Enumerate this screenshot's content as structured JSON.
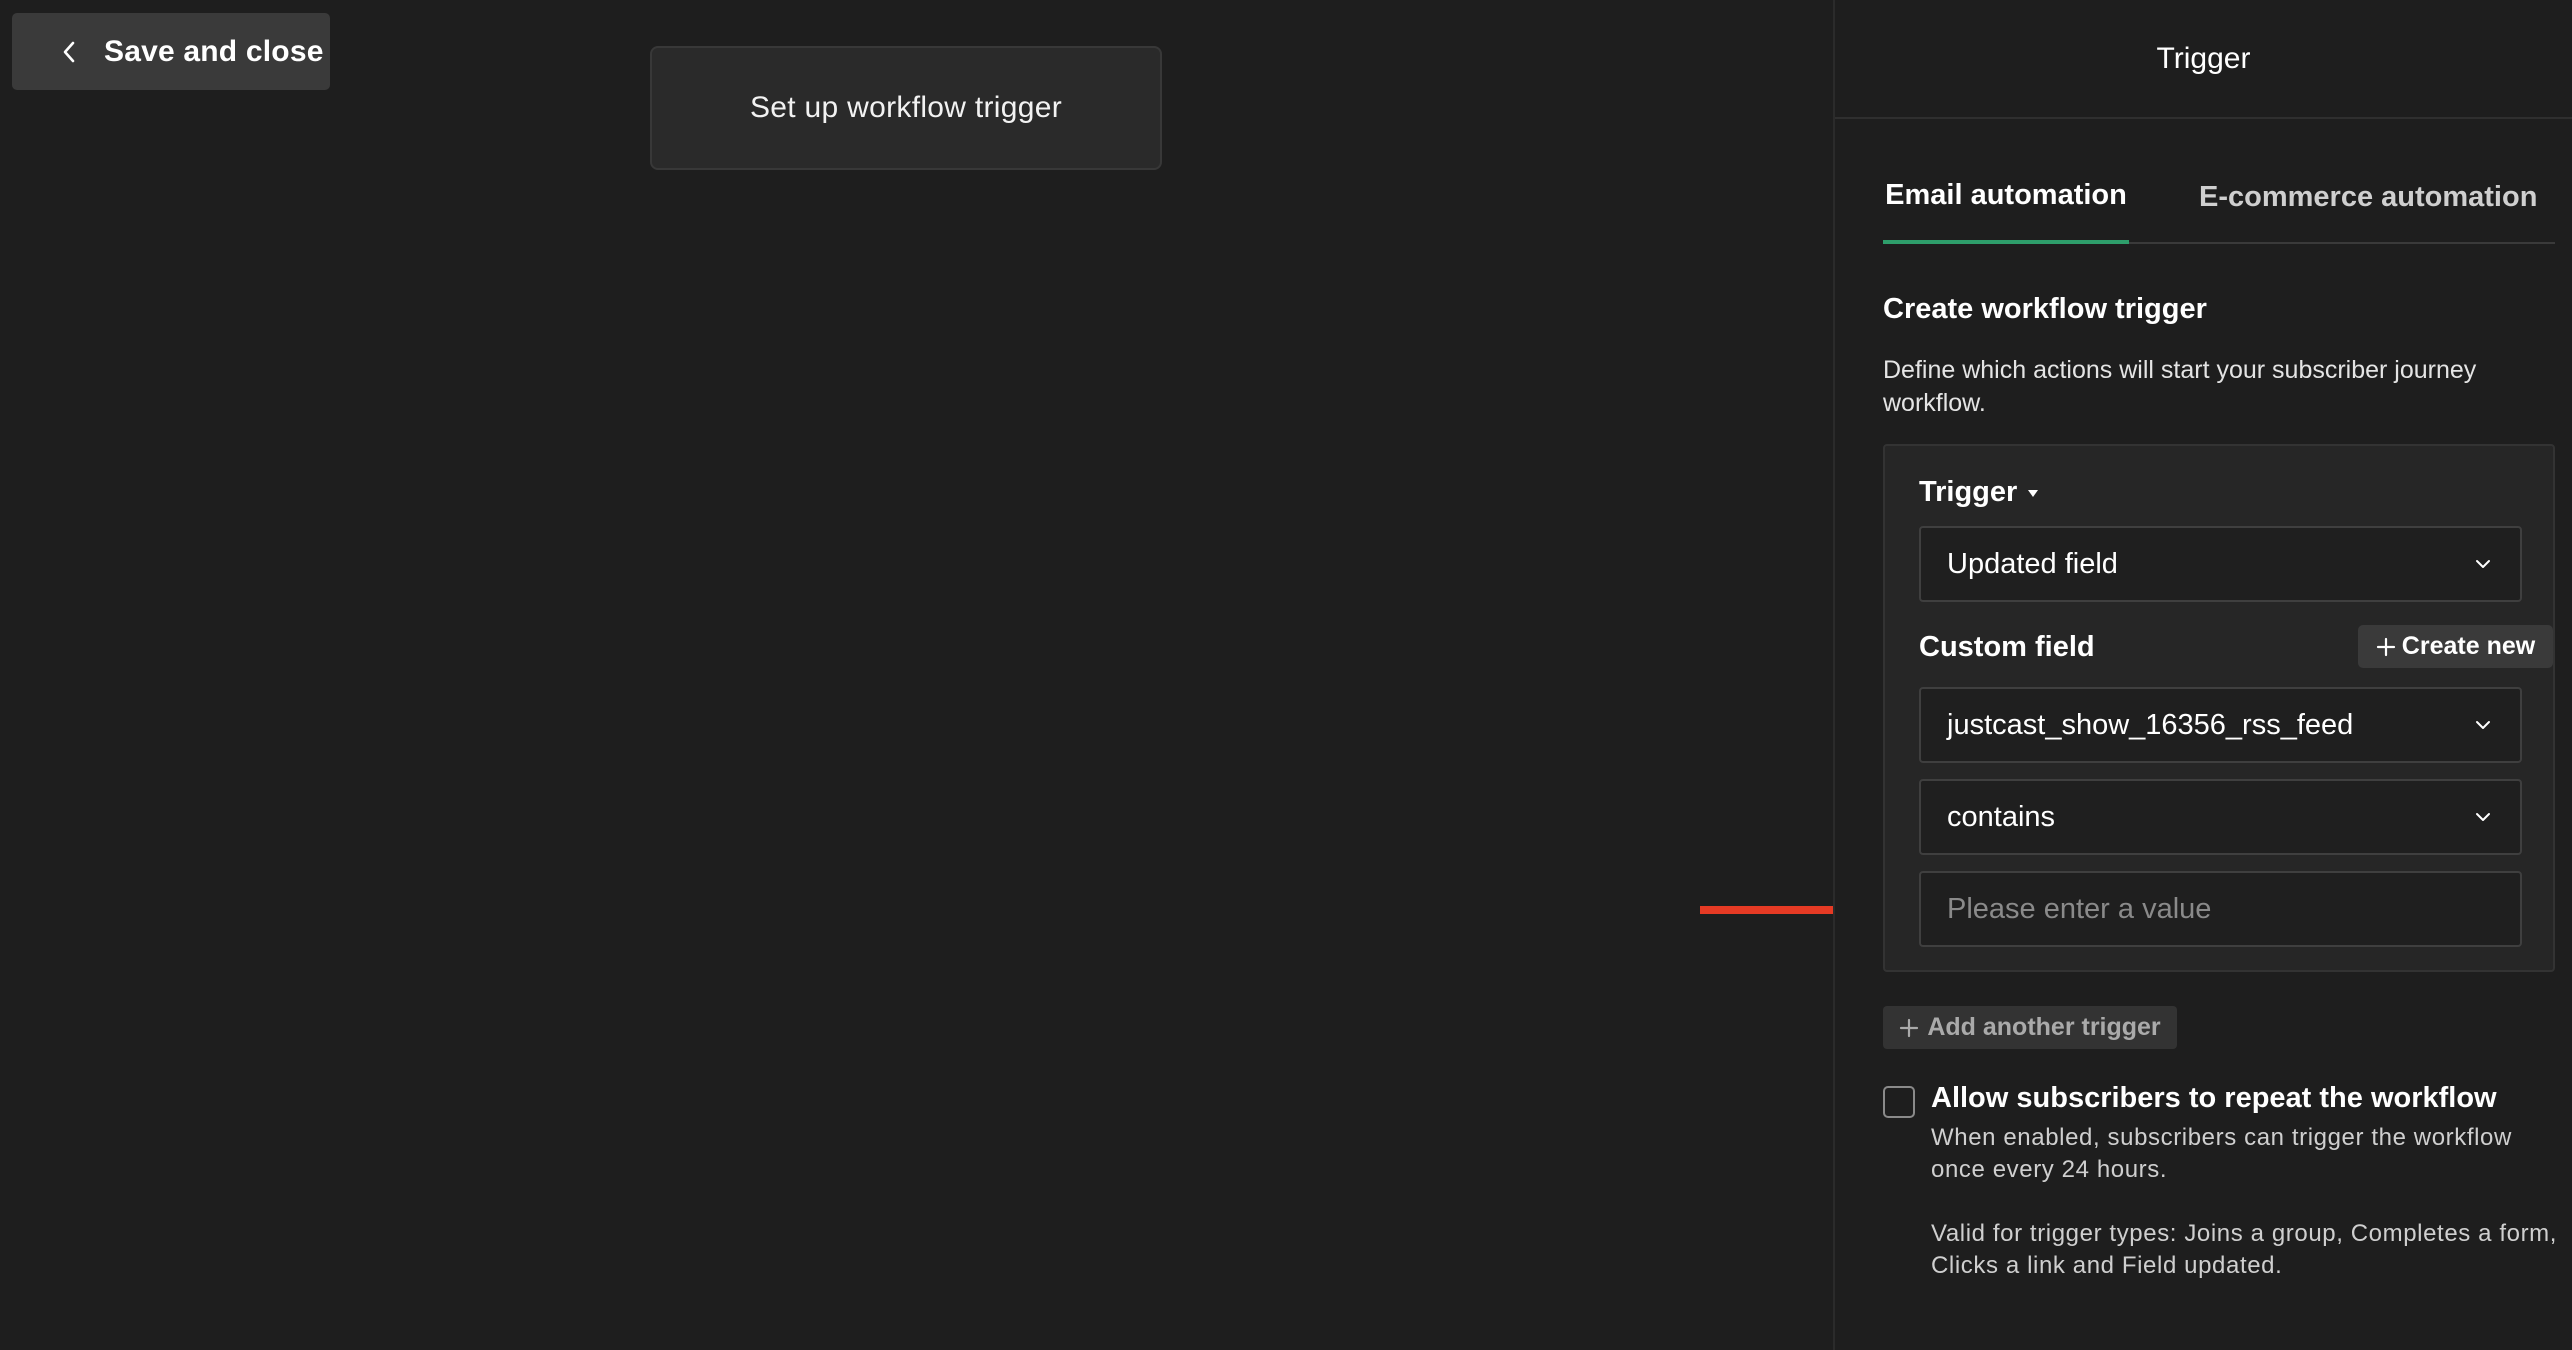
{
  "toolbar": {
    "save_close_label": "Save and close"
  },
  "canvas": {
    "trigger_node_label": "Set up workflow trigger"
  },
  "panel": {
    "title": "Trigger",
    "tabs": [
      {
        "label": "Email automation",
        "active": true
      },
      {
        "label": "E-commerce automation",
        "active": false
      }
    ],
    "section_title": "Create workflow trigger",
    "section_desc": "Define which actions will start your subscriber journey workflow.",
    "trigger_label": "Trigger",
    "trigger_value": "Updated field",
    "custom_field_label": "Custom field",
    "create_new_label": "Create new",
    "custom_field_value": "justcast_show_16356_rss_feed",
    "operator_value": "contains",
    "value_placeholder": "Please enter a value",
    "add_trigger_label": "Add another trigger",
    "repeat_title": "Allow subscribers to repeat the workflow",
    "repeat_desc": "When enabled, subscribers can trigger the workflow once every 24 hours.",
    "repeat_note": "Valid for trigger types: Joins a group, Completes a form, Clicks a link and Field updated.",
    "repeat_checked": false
  },
  "colors": {
    "background": "#1e1e1e",
    "accent_tab": "#2e9e6b",
    "annotation_arrow": "#e63a24"
  }
}
